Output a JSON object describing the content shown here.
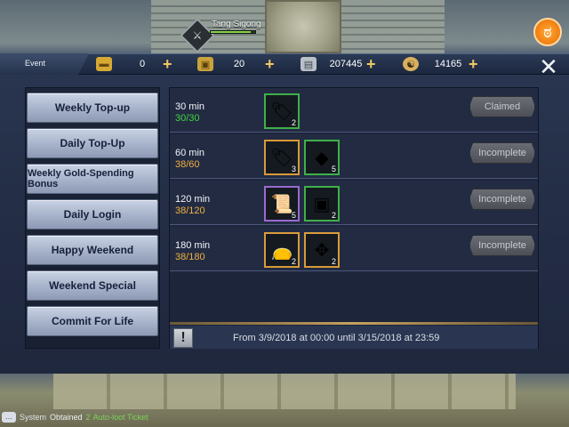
{
  "header": {
    "event_tab": "Event",
    "player_name": "Tang Sigong",
    "player_health_fraction": 0.9,
    "resources": [
      {
        "icon": "gold-ingot-icon",
        "value": "0"
      },
      {
        "icon": "bound-gold-icon",
        "value": "20"
      },
      {
        "icon": "silver-icon",
        "value": "207445"
      },
      {
        "icon": "yin-yang-coin-icon",
        "value": "14165"
      }
    ]
  },
  "menu": [
    {
      "label": "Weekly Top-up"
    },
    {
      "label": "Daily Top-Up"
    },
    {
      "label": "Weekly Gold-Spending Bonus"
    },
    {
      "label": "Daily Login"
    },
    {
      "label": "Happy Weekend"
    },
    {
      "label": "Weekend Special"
    },
    {
      "label": "Commit For Life"
    }
  ],
  "rewards": [
    {
      "time": "30 min",
      "progress": "30/30",
      "progress_color": "#3ed63e",
      "status": "Claimed",
      "items": [
        {
          "icon": "gold-token-icon",
          "qty": "2",
          "border": "green"
        }
      ]
    },
    {
      "time": "60 min",
      "progress": "38/60",
      "progress_color": "#f0b040",
      "status": "Incomplete",
      "items": [
        {
          "icon": "gold-token-icon",
          "qty": "3",
          "border": "orange"
        },
        {
          "icon": "ore-icon",
          "qty": "5",
          "border": "green"
        }
      ]
    },
    {
      "time": "120 min",
      "progress": "38/120",
      "progress_color": "#f0b040",
      "status": "Incomplete",
      "items": [
        {
          "icon": "scroll-icon",
          "qty": "5",
          "border": "purple"
        },
        {
          "icon": "treasure-chest-icon",
          "qty": "2",
          "border": "green"
        }
      ]
    },
    {
      "time": "180 min",
      "progress": "38/180",
      "progress_color": "#f0b040",
      "status": "Incomplete",
      "items": [
        {
          "icon": "pouch-icon",
          "qty": "2",
          "border": "orange"
        },
        {
          "icon": "ornate-scroll-icon",
          "qty": "2",
          "border": "orange"
        }
      ]
    }
  ],
  "footer": {
    "warn_symbol": "!",
    "date_range": "From 3/9/2018 at 00:00 until 3/15/2018 at 23:59"
  },
  "system": {
    "label": "System",
    "obtained": "Obtained",
    "qty": "2",
    "item": "Auto-loot Ticket"
  }
}
